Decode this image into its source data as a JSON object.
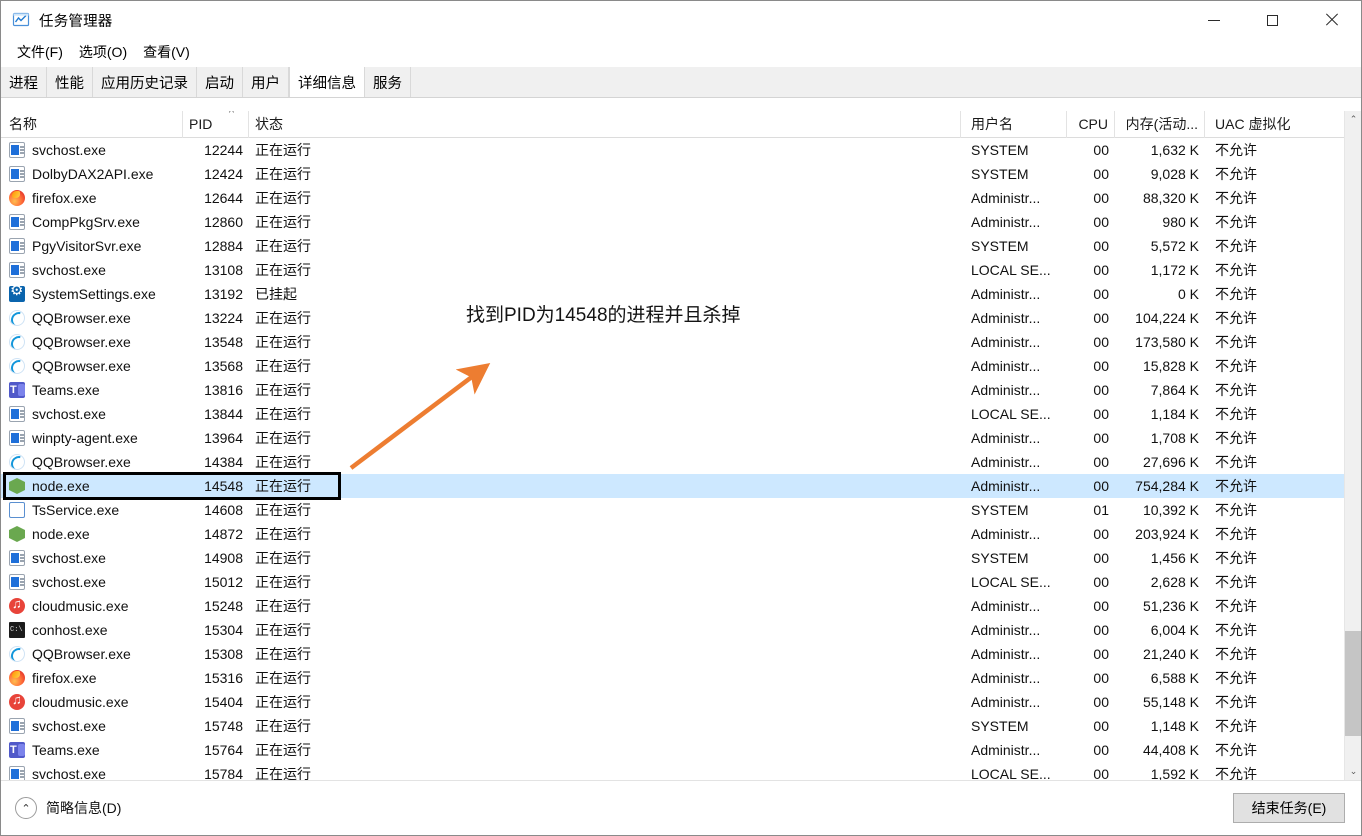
{
  "window": {
    "title": "任务管理器",
    "icon": "task-manager-icon",
    "controls": {
      "minimize": "—",
      "maximize": "□",
      "close": "✕"
    }
  },
  "menubar": {
    "items": [
      "文件(F)",
      "选项(O)",
      "查看(V)"
    ]
  },
  "tabs": {
    "items": [
      "进程",
      "性能",
      "应用历史记录",
      "启动",
      "用户",
      "详细信息",
      "服务"
    ],
    "active": "详细信息"
  },
  "columns": [
    {
      "key": "name",
      "label": "名称",
      "sort": ""
    },
    {
      "key": "pid",
      "label": "PID",
      "sort": "asc"
    },
    {
      "key": "status",
      "label": "状态",
      "sort": ""
    },
    {
      "key": "user",
      "label": "用户名",
      "sort": ""
    },
    {
      "key": "cpu",
      "label": "CPU",
      "sort": ""
    },
    {
      "key": "mem",
      "label": "内存(活动...",
      "sort": ""
    },
    {
      "key": "uac",
      "label": "UAC 虚拟化",
      "sort": ""
    }
  ],
  "sort_indicator": "^",
  "rows": [
    {
      "icon": "svchost",
      "name": "svchost.exe",
      "pid": "12244",
      "status": "正在运行",
      "user": "SYSTEM",
      "cpu": "00",
      "mem": "1,632 K",
      "uac": "不允许",
      "selected": false
    },
    {
      "icon": "svchost",
      "name": "DolbyDAX2API.exe",
      "pid": "12424",
      "status": "正在运行",
      "user": "SYSTEM",
      "cpu": "00",
      "mem": "9,028 K",
      "uac": "不允许",
      "selected": false
    },
    {
      "icon": "firefox",
      "name": "firefox.exe",
      "pid": "12644",
      "status": "正在运行",
      "user": "Administr...",
      "cpu": "00",
      "mem": "88,320 K",
      "uac": "不允许",
      "selected": false
    },
    {
      "icon": "svchost",
      "name": "CompPkgSrv.exe",
      "pid": "12860",
      "status": "正在运行",
      "user": "Administr...",
      "cpu": "00",
      "mem": "980 K",
      "uac": "不允许",
      "selected": false
    },
    {
      "icon": "svchost",
      "name": "PgyVisitorSvr.exe",
      "pid": "12884",
      "status": "正在运行",
      "user": "SYSTEM",
      "cpu": "00",
      "mem": "5,572 K",
      "uac": "不允许",
      "selected": false
    },
    {
      "icon": "svchost",
      "name": "svchost.exe",
      "pid": "13108",
      "status": "正在运行",
      "user": "LOCAL SE...",
      "cpu": "00",
      "mem": "1,172 K",
      "uac": "不允许",
      "selected": false
    },
    {
      "icon": "settings",
      "name": "SystemSettings.exe",
      "pid": "13192",
      "status": "已挂起",
      "user": "Administr...",
      "cpu": "00",
      "mem": "0 K",
      "uac": "不允许",
      "selected": false
    },
    {
      "icon": "qq",
      "name": "QQBrowser.exe",
      "pid": "13224",
      "status": "正在运行",
      "user": "Administr...",
      "cpu": "00",
      "mem": "104,224 K",
      "uac": "不允许",
      "selected": false
    },
    {
      "icon": "qq",
      "name": "QQBrowser.exe",
      "pid": "13548",
      "status": "正在运行",
      "user": "Administr...",
      "cpu": "00",
      "mem": "173,580 K",
      "uac": "不允许",
      "selected": false
    },
    {
      "icon": "qq",
      "name": "QQBrowser.exe",
      "pid": "13568",
      "status": "正在运行",
      "user": "Administr...",
      "cpu": "00",
      "mem": "15,828 K",
      "uac": "不允许",
      "selected": false
    },
    {
      "icon": "teams",
      "name": "Teams.exe",
      "pid": "13816",
      "status": "正在运行",
      "user": "Administr...",
      "cpu": "00",
      "mem": "7,864 K",
      "uac": "不允许",
      "selected": false
    },
    {
      "icon": "svchost",
      "name": "svchost.exe",
      "pid": "13844",
      "status": "正在运行",
      "user": "LOCAL SE...",
      "cpu": "00",
      "mem": "1,184 K",
      "uac": "不允许",
      "selected": false
    },
    {
      "icon": "svchost",
      "name": "winpty-agent.exe",
      "pid": "13964",
      "status": "正在运行",
      "user": "Administr...",
      "cpu": "00",
      "mem": "1,708 K",
      "uac": "不允许",
      "selected": false
    },
    {
      "icon": "qq",
      "name": "QQBrowser.exe",
      "pid": "14384",
      "status": "正在运行",
      "user": "Administr...",
      "cpu": "00",
      "mem": "27,696 K",
      "uac": "不允许",
      "selected": false
    },
    {
      "icon": "node",
      "name": "node.exe",
      "pid": "14548",
      "status": "正在运行",
      "user": "Administr...",
      "cpu": "00",
      "mem": "754,284 K",
      "uac": "不允许",
      "selected": true
    },
    {
      "icon": "blank",
      "name": "TsService.exe",
      "pid": "14608",
      "status": "正在运行",
      "user": "SYSTEM",
      "cpu": "01",
      "mem": "10,392 K",
      "uac": "不允许",
      "selected": false
    },
    {
      "icon": "node",
      "name": "node.exe",
      "pid": "14872",
      "status": "正在运行",
      "user": "Administr...",
      "cpu": "00",
      "mem": "203,924 K",
      "uac": "不允许",
      "selected": false
    },
    {
      "icon": "svchost",
      "name": "svchost.exe",
      "pid": "14908",
      "status": "正在运行",
      "user": "SYSTEM",
      "cpu": "00",
      "mem": "1,456 K",
      "uac": "不允许",
      "selected": false
    },
    {
      "icon": "svchost",
      "name": "svchost.exe",
      "pid": "15012",
      "status": "正在运行",
      "user": "LOCAL SE...",
      "cpu": "00",
      "mem": "2,628 K",
      "uac": "不允许",
      "selected": false
    },
    {
      "icon": "cloudmusic",
      "name": "cloudmusic.exe",
      "pid": "15248",
      "status": "正在运行",
      "user": "Administr...",
      "cpu": "00",
      "mem": "51,236 K",
      "uac": "不允许",
      "selected": false
    },
    {
      "icon": "conhost",
      "name": "conhost.exe",
      "pid": "15304",
      "status": "正在运行",
      "user": "Administr...",
      "cpu": "00",
      "mem": "6,004 K",
      "uac": "不允许",
      "selected": false
    },
    {
      "icon": "qq",
      "name": "QQBrowser.exe",
      "pid": "15308",
      "status": "正在运行",
      "user": "Administr...",
      "cpu": "00",
      "mem": "21,240 K",
      "uac": "不允许",
      "selected": false
    },
    {
      "icon": "firefox",
      "name": "firefox.exe",
      "pid": "15316",
      "status": "正在运行",
      "user": "Administr...",
      "cpu": "00",
      "mem": "6,588 K",
      "uac": "不允许",
      "selected": false
    },
    {
      "icon": "cloudmusic",
      "name": "cloudmusic.exe",
      "pid": "15404",
      "status": "正在运行",
      "user": "Administr...",
      "cpu": "00",
      "mem": "55,148 K",
      "uac": "不允许",
      "selected": false
    },
    {
      "icon": "svchost",
      "name": "svchost.exe",
      "pid": "15748",
      "status": "正在运行",
      "user": "SYSTEM",
      "cpu": "00",
      "mem": "1,148 K",
      "uac": "不允许",
      "selected": false
    },
    {
      "icon": "teams",
      "name": "Teams.exe",
      "pid": "15764",
      "status": "正在运行",
      "user": "Administr...",
      "cpu": "00",
      "mem": "44,408 K",
      "uac": "不允许",
      "selected": false
    },
    {
      "icon": "svchost",
      "name": "svchost.exe",
      "pid": "15784",
      "status": "正在运行",
      "user": "LOCAL SE...",
      "cpu": "00",
      "mem": "1,592 K",
      "uac": "不允许",
      "selected": false
    }
  ],
  "scrollbar": {
    "up_arrow": "⌃",
    "down_arrow": "⌄"
  },
  "bottom": {
    "fewer_details_label": "简略信息(D)",
    "fewer_details_chevron": "⌃",
    "end_task_label": "结束任务(E)"
  },
  "annotation": {
    "text": "找到PID为14548的进程并且杀掉",
    "arrow_color": "#ED7D31",
    "highlight_box_color": "#000000",
    "target_pid": "14548"
  }
}
